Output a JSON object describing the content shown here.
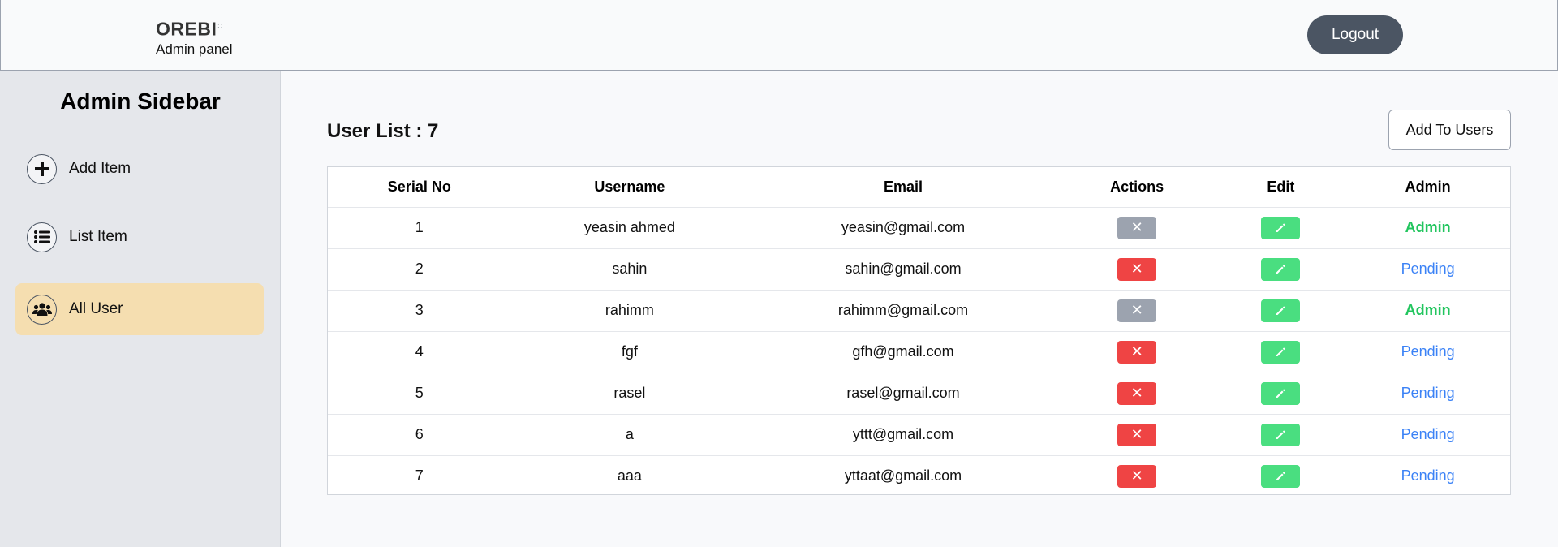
{
  "header": {
    "brand": "OREBI",
    "brand_sub": "Admin panel",
    "logout_label": "Logout"
  },
  "sidebar": {
    "title": "Admin Sidebar",
    "items": [
      {
        "label": "Add Item",
        "icon": "plus-circle-icon",
        "active": false
      },
      {
        "label": "List Item",
        "icon": "list-icon",
        "active": false
      },
      {
        "label": "All User",
        "icon": "users-icon",
        "active": true
      }
    ]
  },
  "main": {
    "title_prefix": "User List : ",
    "user_count": "7",
    "add_button_label": "Add To Users",
    "columns": [
      "Serial No",
      "Username",
      "Email",
      "Actions",
      "Edit",
      "Admin"
    ],
    "rows": [
      {
        "serial": "1",
        "username": "yeasin ahmed",
        "email": "yeasin@gmail.com",
        "delete_enabled": false,
        "status": "Admin"
      },
      {
        "serial": "2",
        "username": "sahin",
        "email": "sahin@gmail.com",
        "delete_enabled": true,
        "status": "Pending"
      },
      {
        "serial": "3",
        "username": "rahimm",
        "email": "rahimm@gmail.com",
        "delete_enabled": false,
        "status": "Admin"
      },
      {
        "serial": "4",
        "username": "fgf",
        "email": "gfh@gmail.com",
        "delete_enabled": true,
        "status": "Pending"
      },
      {
        "serial": "5",
        "username": "rasel",
        "email": "rasel@gmail.com",
        "delete_enabled": true,
        "status": "Pending"
      },
      {
        "serial": "6",
        "username": "a",
        "email": "yttt@gmail.com",
        "delete_enabled": true,
        "status": "Pending"
      },
      {
        "serial": "7",
        "username": "aaa",
        "email": "yttaat@gmail.com",
        "delete_enabled": true,
        "status": "Pending"
      }
    ]
  },
  "colors": {
    "logout_bg": "#4b5563",
    "active_sidebar": "#f5deb0",
    "delete_active": "#ef4444",
    "delete_disabled": "#9ca3af",
    "edit": "#4ade80",
    "admin_status": "#22c55e",
    "pending_status": "#3b82f6"
  }
}
